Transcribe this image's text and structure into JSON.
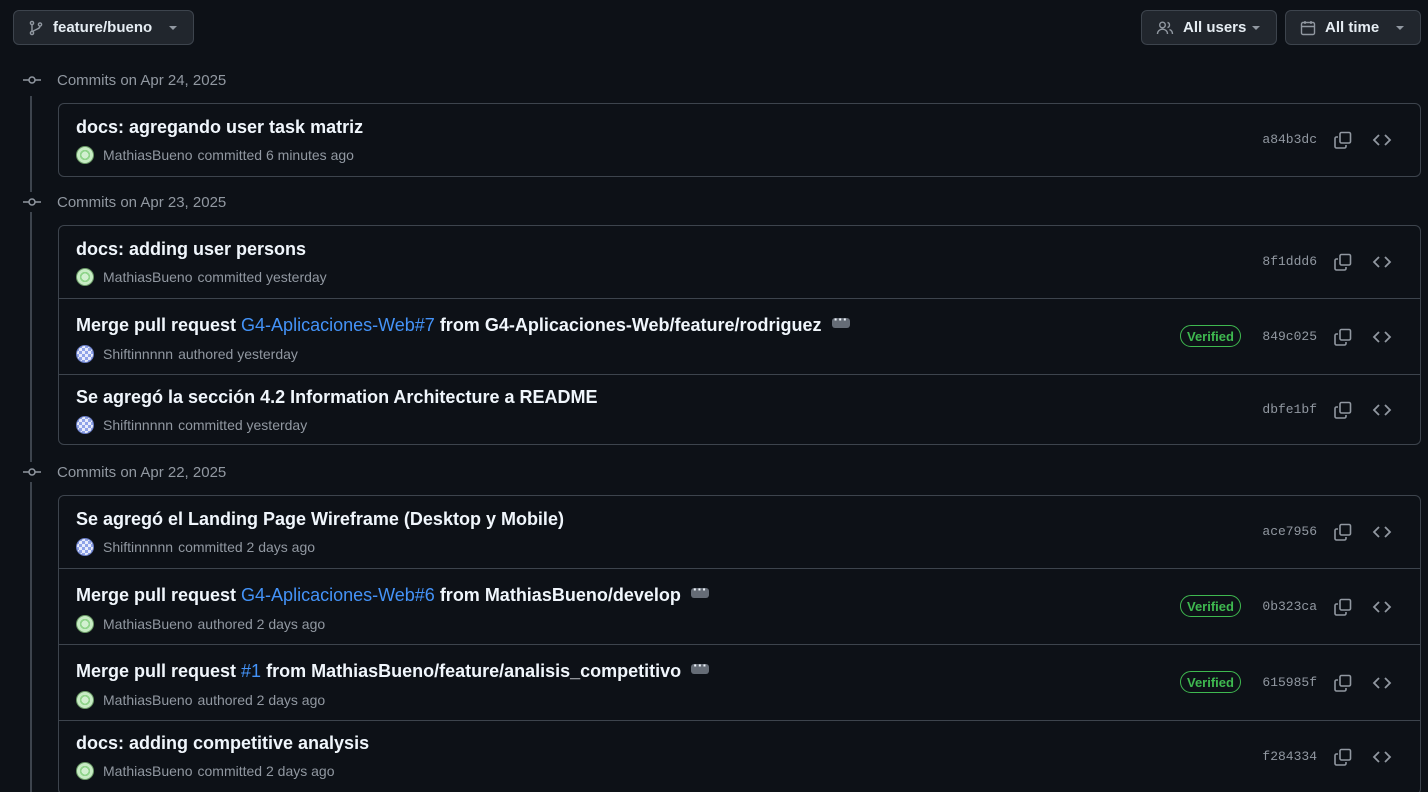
{
  "filters": {
    "branch": "feature/bueno",
    "users": "All users",
    "time": "All time"
  },
  "groups": [
    {
      "date_label": "Commits on Apr 24, 2025",
      "commits": [
        {
          "message": "docs: agregando user task matriz",
          "author": "MathiasBueno",
          "action": "committed 6 minutes ago",
          "sha": "a84b3dc"
        }
      ]
    },
    {
      "date_label": "Commits on Apr 23, 2025",
      "commits": [
        {
          "message": "docs: adding user persons",
          "author": "MathiasBueno",
          "action": "committed yesterday",
          "sha": "8f1ddd6"
        },
        {
          "message_prefix": "Merge pull request ",
          "message_link": "G4-Aplicaciones-Web#7",
          "message_suffix": " from G4-Aplicaciones-Web/feature/rodriguez",
          "author": "Shiftinnnnn",
          "action": "authored yesterday",
          "verified": "Verified",
          "sha": "849c025"
        },
        {
          "message": "Se agregó la sección 4.2 Information Architecture a README",
          "author": "Shiftinnnnn",
          "action": "committed yesterday",
          "sha": "dbfe1bf"
        }
      ]
    },
    {
      "date_label": "Commits on Apr 22, 2025",
      "commits": [
        {
          "message": "Se agregó el Landing Page Wireframe (Desktop y Mobile)",
          "author": "Shiftinnnnn",
          "action": "committed 2 days ago",
          "sha": "ace7956"
        },
        {
          "message_prefix": "Merge pull request ",
          "message_link": "G4-Aplicaciones-Web#6",
          "message_suffix": " from MathiasBueno/develop",
          "author": "MathiasBueno",
          "action": "authored 2 days ago",
          "verified": "Verified",
          "sha": "0b323ca"
        },
        {
          "message_prefix": "Merge pull request ",
          "message_link": "#1",
          "message_suffix": " from MathiasBueno/feature/analisis_competitivo",
          "author": "MathiasBueno",
          "action": "authored 2 days ago",
          "verified": "Verified",
          "sha": "615985f"
        },
        {
          "message": "docs: adding competitive analysis",
          "author": "MathiasBueno",
          "action": "committed 2 days ago",
          "sha": "f284334"
        }
      ]
    }
  ]
}
